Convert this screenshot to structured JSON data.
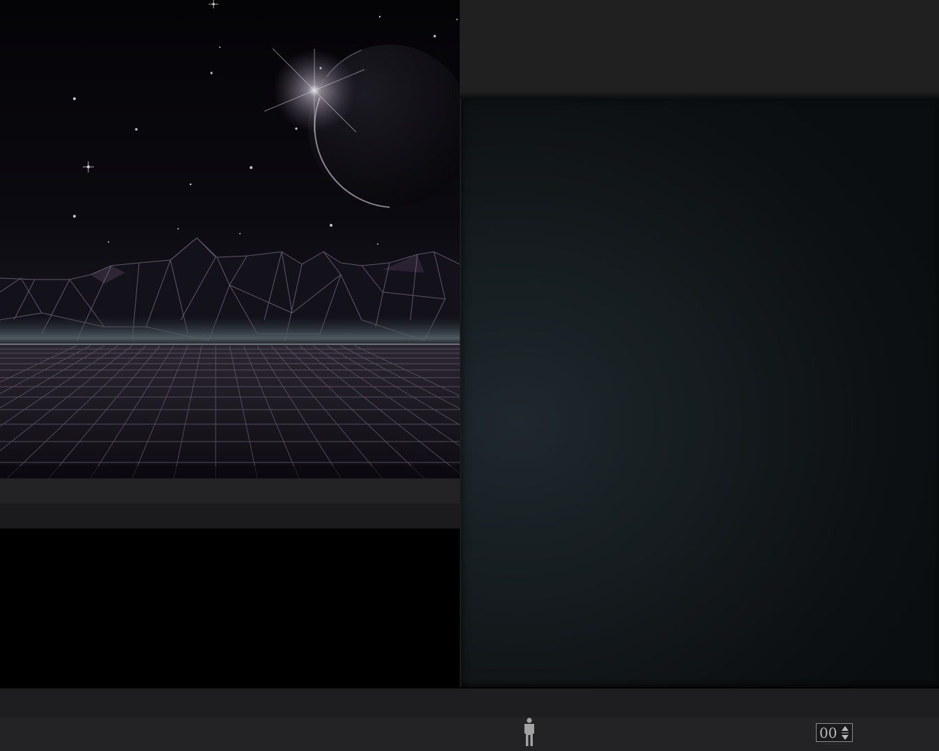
{
  "wallpaper": {
    "description_icon": "synthwave-landscape",
    "colors": {
      "grid_line": "#6b5a76",
      "mountain_line": "#8a7a95",
      "planet_rim": "#b9aec0",
      "horizon_glow": "#6e7a80"
    }
  },
  "taskbar": {
    "user_icon": "person-icon",
    "counter": {
      "value": "00",
      "icon": "up-down-arrows-icon"
    }
  },
  "colors": {
    "panel_header": "#202020",
    "panel_body": "#151b1e",
    "taskbar": "#232326",
    "bottom_band": "#1e1e20"
  }
}
